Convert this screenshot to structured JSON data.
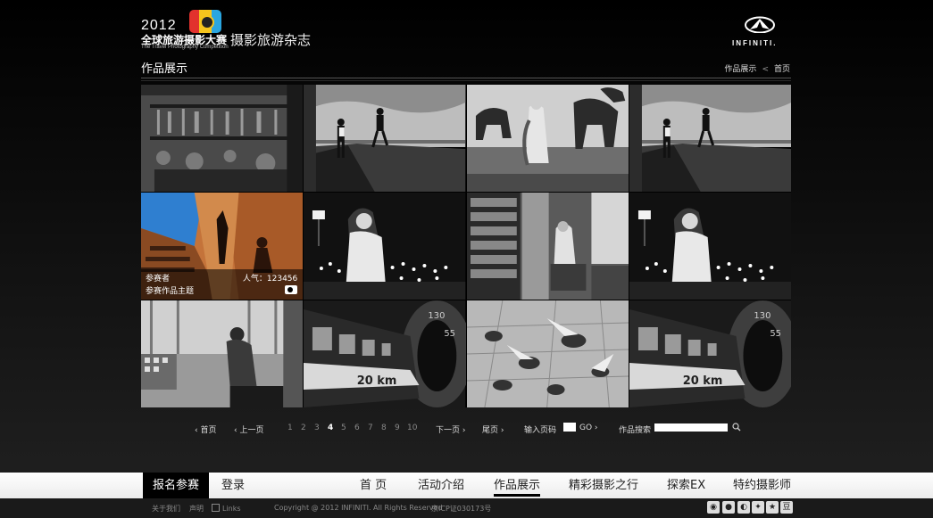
{
  "header": {
    "logo_year": "2012",
    "logo_title": "全球旅游摄影大赛",
    "logo_subtitle": "The Travel Photography Competition",
    "magazine": "摄影旅游杂志",
    "brand_name": "INFINITI."
  },
  "section": {
    "title": "作品展示",
    "breadcrumb": [
      "作品展示",
      "首页"
    ],
    "breadcrumb_separator": "<"
  },
  "gallery": {
    "tiles": [
      {
        "subject": "shelves-of-tools-bw"
      },
      {
        "subject": "seaside-walkers-bw"
      },
      {
        "subject": "camels-and-woman-bw"
      },
      {
        "subject": "seaside-walkers-bw"
      },
      {
        "subject": "boy-on-stairs-color",
        "hovered": true
      },
      {
        "subject": "woman-with-candles-bw"
      },
      {
        "subject": "woman-in-library-bw"
      },
      {
        "subject": "woman-with-candles-bw"
      },
      {
        "subject": "man-at-window-bw"
      },
      {
        "subject": "train-in-tunnel-bw"
      },
      {
        "subject": "birds-on-pavement-bw"
      },
      {
        "subject": "train-in-tunnel-bw"
      }
    ],
    "hover_caption": {
      "author": "参赛者",
      "topic": "参赛作品主题",
      "popularity": "人气：123456"
    }
  },
  "pagination": {
    "first": "首页",
    "prev": "上一页",
    "pages": [
      "1",
      "2",
      "3",
      "4",
      "5",
      "6",
      "7",
      "8",
      "9",
      "10"
    ],
    "current": "4",
    "next": "下一页",
    "last": "尾页",
    "goto_label": "输入页码",
    "go_label": "GO",
    "search_label": "作品搜索"
  },
  "nav": {
    "signup": "报名参赛",
    "login": "登录",
    "items": [
      "首 页",
      "活动介绍",
      "作品展示",
      "精彩摄影之行",
      "探索EX",
      "特约摄影师"
    ],
    "active": "作品展示"
  },
  "footer": {
    "about": "关于我们",
    "statement": "声明",
    "links": "Links",
    "copyright": "Copyright @ 2012  INFINITI. All Rights Reserved",
    "icp": "京ICP证030173号",
    "social_icons": [
      "rss-icon",
      "panda-icon",
      "weibo-icon",
      "kaixin-icon",
      "qzone-icon",
      "douban-icon"
    ]
  }
}
